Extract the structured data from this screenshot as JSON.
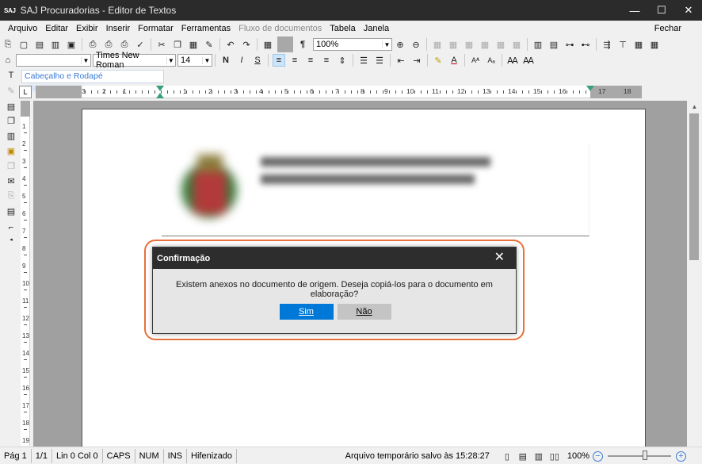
{
  "window": {
    "logo": "SAJ",
    "title": "SAJ Procuradorias - Editor de Textos",
    "minimize": "—",
    "maximize": "☐",
    "close": "✕"
  },
  "menu": {
    "items": [
      "Arquivo",
      "Editar",
      "Exibir",
      "Inserir",
      "Formatar",
      "Ferramentas",
      "Fluxo de documentos",
      "Tabela",
      "Janela"
    ],
    "disabled": [
      "Fluxo de documentos"
    ],
    "fechar": "Fechar"
  },
  "toolbar": {
    "zoom_value": "100%",
    "font_name": "Times New Roman",
    "font_size": "14",
    "bold_label": "N",
    "italic_label": "I",
    "underline_label": "S",
    "pilcrow": "¶"
  },
  "header_tab": {
    "label": "Cabeçalho e Rodapé"
  },
  "ruler": {
    "numbers": [
      "3",
      "2",
      "1",
      "1",
      "2",
      "3",
      "4",
      "5",
      "6",
      "7",
      "8",
      "9",
      "10",
      "11",
      "12",
      "13",
      "14",
      "15",
      "16",
      "17",
      "18"
    ],
    "corner": "L"
  },
  "vruler": {
    "numbers": [
      "1",
      "2",
      "3",
      "4",
      "5",
      "6",
      "7",
      "8",
      "9",
      "10",
      "11",
      "12",
      "13",
      "14",
      "15",
      "16",
      "17",
      "18",
      "19"
    ]
  },
  "dialog": {
    "title": "Confirmação",
    "message": "Existem anexos no documento de origem. Deseja copiá-los para o documento em elaboração?",
    "yes_label": "Sim",
    "no_label": "Não",
    "close": "✕"
  },
  "status": {
    "page": "Pág 1",
    "pages": "1/1",
    "position": "Lin 0  Col 0",
    "caps": "CAPS",
    "num": "NUM",
    "ins": "INS",
    "hyphen": "Hifenizado",
    "saved": "Arquivo temporário salvo às 15:28:27",
    "zoom": "100%",
    "zoom_minus": "−",
    "zoom_plus": "+"
  },
  "colors": {
    "accent": "#0078d7",
    "highlight": "#e8703a",
    "titlebar": "#2b2b2b"
  }
}
